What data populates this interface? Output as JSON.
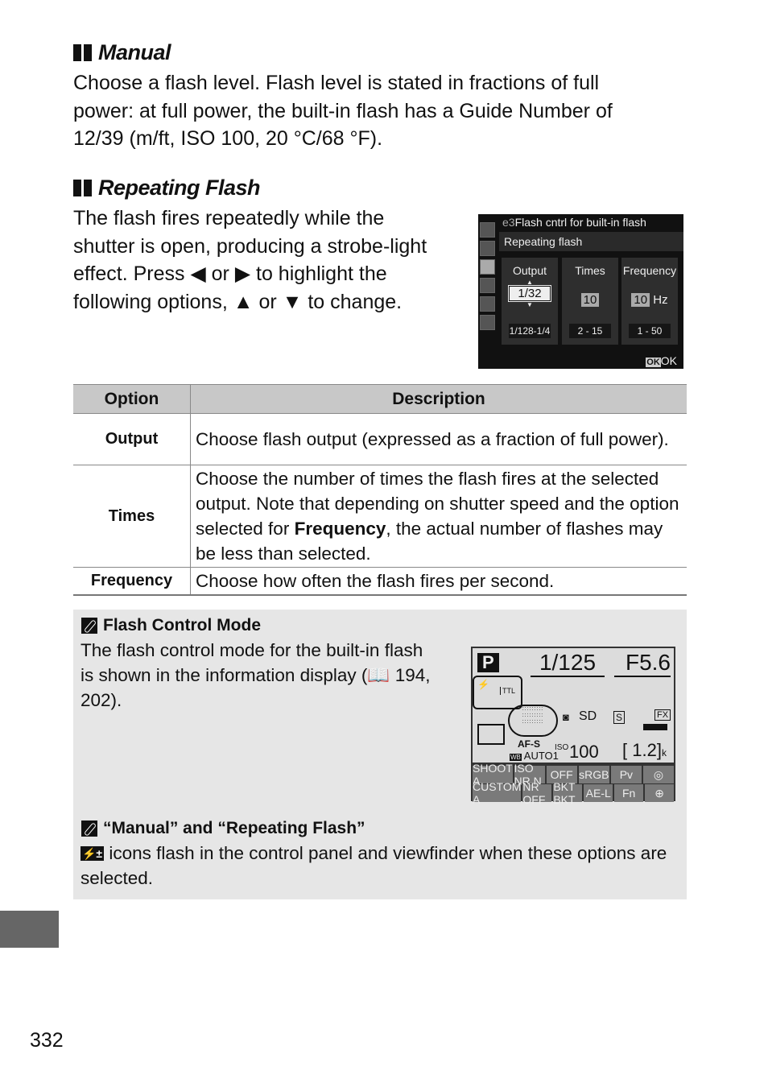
{
  "sections": {
    "manual": {
      "heading": "Manual",
      "lines": [
        "Choose a flash level.  Flash level is stated in fractions of full",
        "power: at full power, the built-in flash has a Guide Number of",
        "12/39 (m/ft, ISO 100, 20 °C/68 °F)."
      ]
    },
    "repeating": {
      "heading": "Repeating Flash",
      "lines": [
        "The flash fires repeatedly while the",
        "shutter is open, producing a strobe-light",
        "effect.  Press",
        "or",
        "to highlight the",
        "following options,",
        "or",
        "to change."
      ]
    }
  },
  "camera_menu": {
    "menu_code": "e3",
    "title": "Flash cntrl for built-in flash",
    "subtitle": "Repeating flash",
    "columns": [
      {
        "label": "Output",
        "value": "1/32",
        "range": "1/128-1/4"
      },
      {
        "label": "Times",
        "value": "10",
        "range": "2 - 15"
      },
      {
        "label": "Frequency",
        "value": "10",
        "unit": "Hz",
        "range": "1 - 50"
      }
    ],
    "ok_label": "OK",
    "ok_badge": "OK"
  },
  "table": {
    "headers": [
      "Option",
      "Description"
    ],
    "rows": [
      {
        "option": "Output",
        "description": "Choose flash output (expressed as a fraction of full power)."
      },
      {
        "option": "Times",
        "description_pre": "Choose the number of times the flash fires at the selected output.  Note that depending on shutter speed and the option selected for ",
        "description_bold": "Frequency",
        "description_post": ", the actual number of flashes may be less than selected."
      },
      {
        "option": "Frequency",
        "description": "Choose how often the flash fires per second."
      }
    ]
  },
  "notes": [
    {
      "title": "Flash Control Mode",
      "lines": [
        "The flash control mode for the built-in flash",
        "is shown in the information display (",
        "194,",
        "202)."
      ]
    },
    {
      "title": "“Manual” and “Repeating Flash”",
      "text": "icons flash in the control panel and viewfinder when these options are selected."
    }
  ],
  "info_display": {
    "mode": "P",
    "shutter": "1/125",
    "aperture": "F5.6",
    "flash_mode": "TTL",
    "iso_label": "ISO",
    "iso": "100",
    "focus": "AF-S",
    "wb": "AUTO1",
    "remaining": "1.2",
    "remaining_unit": "k",
    "area": "FX",
    "sd": "SD",
    "row1": [
      "SHOOT A",
      "ISO NR N",
      "OFF",
      "sRGB",
      "Pv",
      "◎"
    ],
    "row2": [
      "CUSTOM A",
      "NR OFF",
      "BKT BKT",
      "AE-L",
      "Fn",
      "⊕"
    ]
  },
  "page_number": "332"
}
